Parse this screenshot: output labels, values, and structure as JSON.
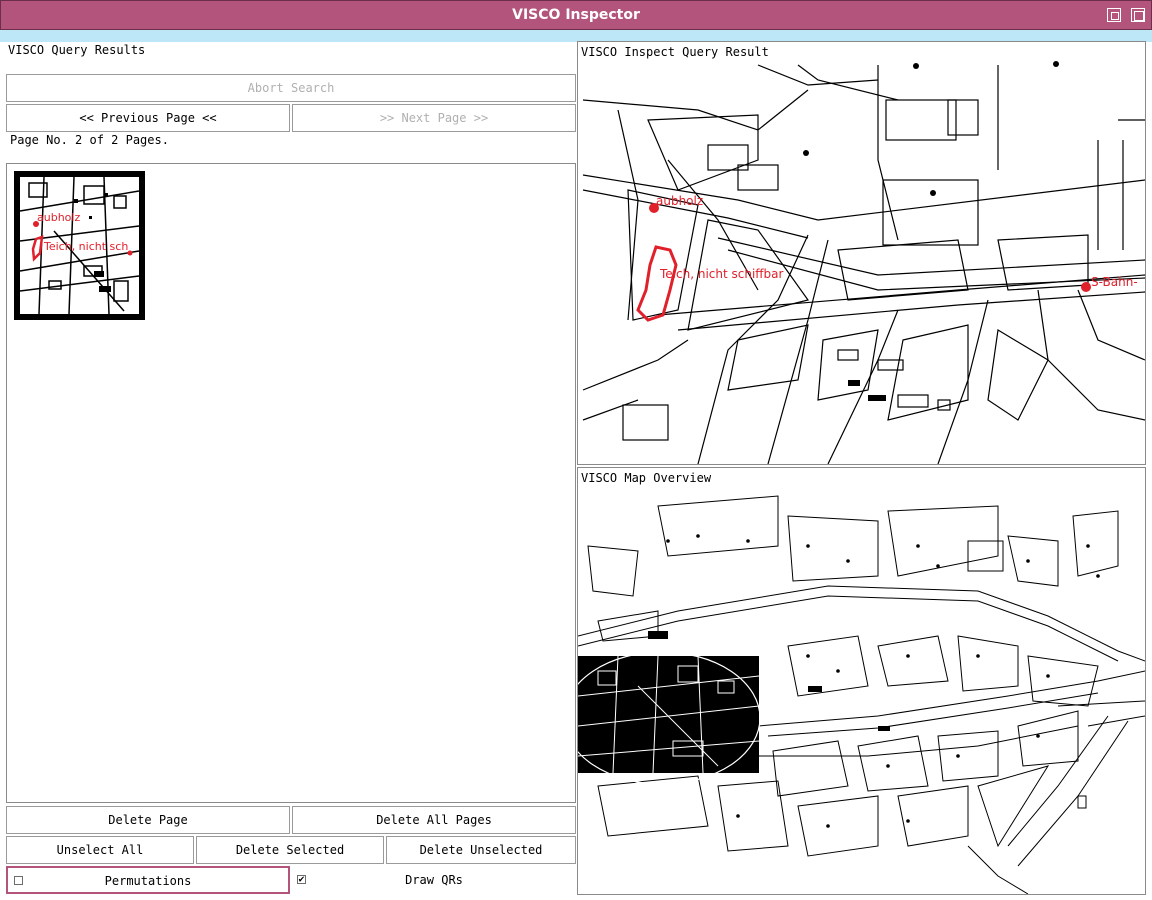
{
  "window": {
    "title": "VISCO Inspector"
  },
  "query_results": {
    "title": "VISCO Query Results",
    "abort_label": "Abort Search",
    "prev_label": "<< Previous Page <<",
    "next_label": ">> Next Page >>",
    "page_info": "Page No. 2 of 2 Pages.",
    "thumbnail_labels": [
      "aubholz",
      "Teich, nicht sch"
    ]
  },
  "inspect": {
    "title": "VISCO Inspect Query Result",
    "labels": [
      "aubholz",
      "Teich, nicht schiffbar",
      "S-Bahn-"
    ]
  },
  "overview": {
    "title": "VISCO Map Overview"
  },
  "buttons": {
    "delete_page": "Delete Page",
    "delete_all_pages": "Delete All Pages",
    "unselect_all": "Unselect All",
    "delete_selected": "Delete Selected",
    "delete_unselected": "Delete Unselected",
    "permutations": "Permutations",
    "draw_qrs": "Draw QRs"
  },
  "checkboxes": {
    "permutations_checked": false,
    "draw_qrs_checked": true
  },
  "colors": {
    "titlebar": "#b3547c",
    "accent_strip": "#bde7f7",
    "annotation_red": "#e0202a"
  }
}
